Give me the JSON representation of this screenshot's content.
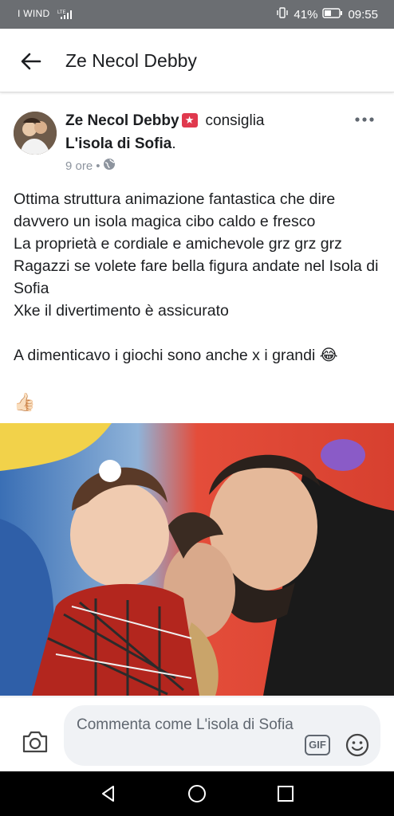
{
  "status_bar": {
    "carrier": "I WIND",
    "network": "LTE",
    "battery": "41%",
    "time": "09:55"
  },
  "app_bar": {
    "title": "Ze Necol Debby",
    "back_icon": "arrow-left-icon"
  },
  "post": {
    "author": "Ze Necol Debby",
    "badge_icon": "star-badge-icon",
    "verb": "consiglia",
    "page": "L'isola di Sofia",
    "page_suffix": ".",
    "time": "9 ore",
    "separator": "•",
    "audience_icon": "globe-icon",
    "more_icon": "more-dots-icon",
    "lines": [
      "Ottima struttura animazione fantastica che dire davvero un isola magica cibo caldo e fresco",
      "La proprietà e cordiale e amichevole grz grz grz",
      "Ragazzi se volete fare bella figura andate nel Isola di Sofia",
      "Xke il divertimento è assicurato"
    ],
    "closing_line": "A dimenticavo i giochi sono anche x i grandi 😂",
    "reaction_emoji": "👍🏻",
    "photo_icon": "post-photo"
  },
  "comment_bar": {
    "placeholder": "Commenta come L'isola di Sofia",
    "camera_icon": "camera-icon",
    "gif_label": "GIF",
    "emoji_icon": "smiley-icon"
  },
  "nav_bar": {
    "back_icon": "triangle-back-icon",
    "home_icon": "circle-home-icon",
    "recents_icon": "square-recents-icon"
  }
}
